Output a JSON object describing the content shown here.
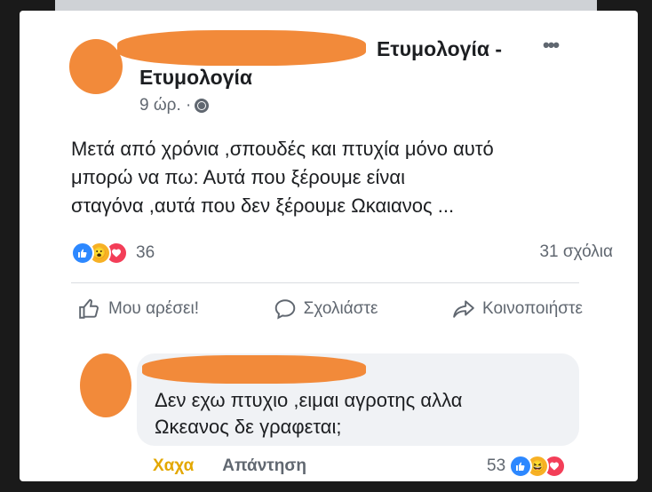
{
  "post": {
    "page_name_part1": "Ετυμολογία -",
    "page_name_part2": "Ετυμολογία",
    "time": "9 ώρ. ·",
    "more_icon": "more-dots",
    "body_lines": [
      "Μετά από χρόνια ,σπουδές και πτυχία μόνο αυτό",
      "μπορώ να πω: Αυτά που ξέρουμε είναι",
      "σταγόνα ,αυτά που δεν ξέρουμε Ωκαιανος ..."
    ],
    "reaction_count": "36",
    "comments_count": "31 σχόλια"
  },
  "actions": {
    "like": "Μου αρέσει!",
    "comment": "Σχολιάστε",
    "share": "Κοινοποιήστε"
  },
  "comment": {
    "lines": [
      "Δεν εχω πτυχιο ,ειμαι αγροτης αλλα",
      "Ωκεανος δε γραφεται;"
    ],
    "reaction_label": "Χαχα",
    "reply_label": "Απάντηση",
    "reaction_count": "53"
  },
  "colors": {
    "like_blue": "#2d88ff",
    "love_red": "#f33e58",
    "haha_yellow": "#f7b125",
    "redaction_orange": "#f28a3a"
  }
}
